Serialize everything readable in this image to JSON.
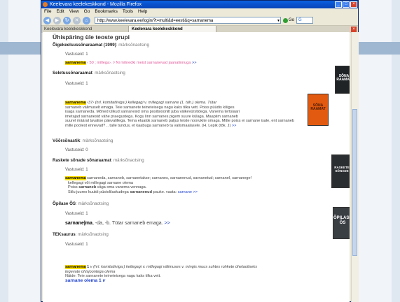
{
  "window": {
    "title": "Keelevara keelekeskkond - Mozilla Firefox",
    "controls": [
      "_",
      "□",
      "×"
    ]
  },
  "menu": [
    "File",
    "Edit",
    "View",
    "Go",
    "Bookmarks",
    "Tools",
    "Help"
  ],
  "address": {
    "url": "http://www.keelevara.ee/login/?t=multi&d=eesti&q=sarnanema",
    "go_label": "Go",
    "search_label": "G"
  },
  "tabs": [
    "Keelevara keelekeskkond",
    "Keelevara keelekeskkond"
  ],
  "page": {
    "heading": "Ühispäring üle teoste grupi",
    "sections": [
      {
        "title": "Õigekeelsussõnaraamat (1999)",
        "subtitle": ": märksõnaotsing",
        "hits": "Vastuseid: 1",
        "entry_word": "sarnanema",
        "entry_rest": " ‹ 50 ; millega›. ◊ Ni mõnedki meist sarnanevad jaanalinnuga",
        "more": ">>"
      },
      {
        "title": "Seletussõnaraamat",
        "subtitle": ": märksõnaotsing",
        "hits": "Vastuseid: 1",
        "entry_word": "sarnanema",
        "entry_line1": " ‹37› (hrl. komitatiiviga:) kellegagi v. millegagi sarnane (1. täh.) olema. Tütar",
        "entry_line2": "sarnaneb välimuselt emaga. Teie sarnanete teineteisega nagu kaks tilka vett. Poiss püüdis kõiges",
        "entry_line3": "isaga sarnaneda. Mõned ülikud sarnanesid oma positsioonilt juba väikevürstidega. Vanema tertsiaari",
        "entry_line4": "imetajad sarnanesid vähe praegustega. Kogu linn sarnanes pigem suure külaga. Maapiim sarnaneb",
        "entry_line5": "suurel määral tavalise päevalillega. Tema eluaiük sarnaneb paljus teiste noorukite omaga. Mitte poiss ei sarnane isale, ent sarnaneb",
        "entry_line6": "mille poolest ennevad? .. talle tundus, et kaabuga sarnaneb ta valismaalasele. (H. Lepik (tõk. J)",
        "more": ">>"
      },
      {
        "title": "Võõrsõnastik",
        "subtitle": ": märksõnaotsing",
        "hits": "Vastuseid: 0"
      },
      {
        "title": "Raskete sõnade sõnaraamat",
        "subtitle": ": märksõnaotsing",
        "hits": "Vastuseid: 1",
        "entry_word": "sarnanema",
        "entry_line1": " sarnaneda, sarnaneb, sarnanetakse; sarnanes, sarnanenud, sarnanetud; sarnanel, sarnanege!",
        "entry_line2": "kellegagi või millegagi sarnane olema",
        "entry_line3_pre": "Poiss ",
        "entry_line3_bold": "sarnaneb",
        "entry_line3_post": " väga oma vanema vennaga.",
        "entry_line4_pre": "Siilu juures kuuldi püstolilaskudega ",
        "entry_line4_bold": "sarnanenud",
        "entry_line4_post": " pauke. vaata: ",
        "entry_line4_link": "sarnane",
        "more": ">>"
      },
      {
        "title": "Õpilase ÕS",
        "subtitle": ": märksõnaotsing",
        "hits": "Vastuseid: 1",
        "entry_word": "sarnane|ma",
        "entry_rest": ", -da, -b. Tütar sarnaneb emaga.",
        "more": ">>"
      },
      {
        "title": "TEKsaurus",
        "subtitle": ": märksõnaotsing",
        "hits": "Vastuseid: 1",
        "entry_word": "sarnanema",
        "entry_num": " 1",
        "entry_line1": " v (hrl. komitatiiviga:) kellegagi v. millegagi välimuses v. mingis muus suhtes rohkete ühetaoliseks",
        "entry_line2": "tegevate ühisjoontega olema",
        "entry_line3": "Näide: Teie sarnanete teineteisega nagu kaks tilka vett.",
        "entry_line4": "sarnane olema 1",
        "entry_line4_suffix": " v"
      }
    ]
  },
  "books": [
    {
      "label": "SÕNA RAAMAT",
      "color": "#1f2326"
    },
    {
      "label": "SÕNA RAAMAT",
      "color": "#e25a10"
    },
    {
      "label": "RASKETE SÕNADE",
      "color": "#2b2e31"
    },
    {
      "label": "ÕPILASE ÕS",
      "color": "#3a3f44"
    }
  ]
}
